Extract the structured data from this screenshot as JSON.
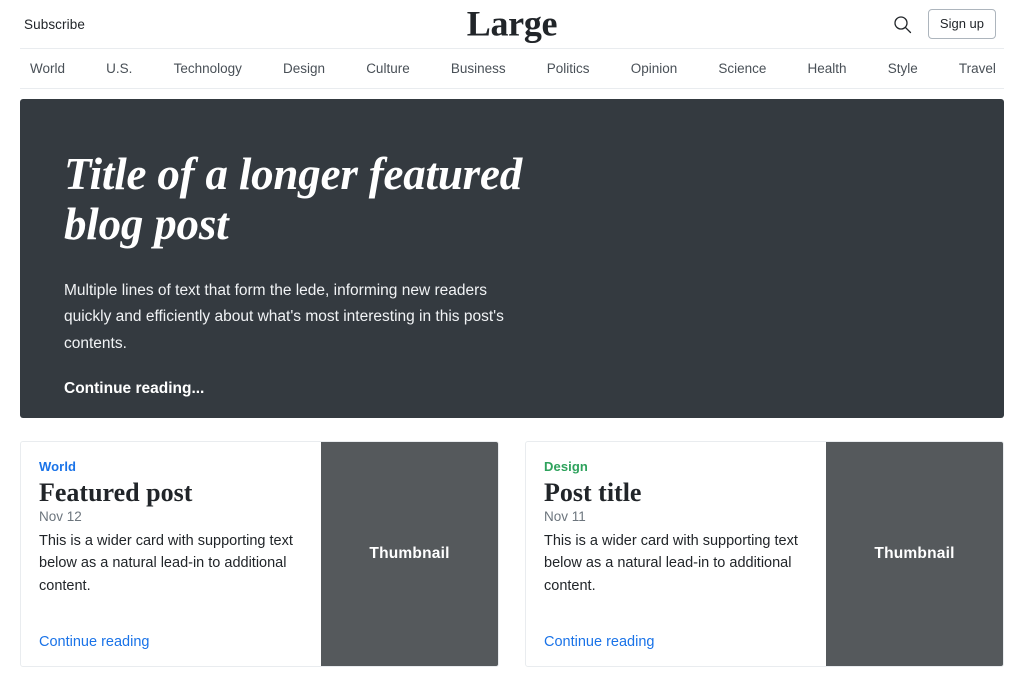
{
  "masthead": {
    "subscribe_label": "Subscribe",
    "blog_title": "Large",
    "search_icon": "search-icon",
    "signup_label": "Sign up"
  },
  "nav": {
    "items": [
      {
        "label": "World"
      },
      {
        "label": "U.S."
      },
      {
        "label": "Technology"
      },
      {
        "label": "Design"
      },
      {
        "label": "Culture"
      },
      {
        "label": "Business"
      },
      {
        "label": "Politics"
      },
      {
        "label": "Opinion"
      },
      {
        "label": "Science"
      },
      {
        "label": "Health"
      },
      {
        "label": "Style"
      },
      {
        "label": "Travel"
      }
    ]
  },
  "hero": {
    "title": "Title of a longer featured blog post",
    "lede": "Multiple lines of text that form the lede, informing new readers quickly and efficiently about what's most interesting in this post's contents.",
    "cta_label": "Continue reading...",
    "background_color": "#343a40"
  },
  "cards": [
    {
      "category": "World",
      "category_color": "#1a73e8",
      "title": "Featured post",
      "date": "Nov 12",
      "text": "This is a wider card with supporting text below as a natural lead-in to additional content.",
      "link_label": "Continue reading",
      "thumbnail_label": "Thumbnail",
      "thumbnail_color": "#55595c"
    },
    {
      "category": "Design",
      "category_color": "#2ea25c",
      "title": "Post title",
      "date": "Nov 11",
      "text": "This is a wider card with supporting text below as a natural lead-in to additional content.",
      "link_label": "Continue reading",
      "thumbnail_label": "Thumbnail",
      "thumbnail_color": "#55595c"
    }
  ]
}
